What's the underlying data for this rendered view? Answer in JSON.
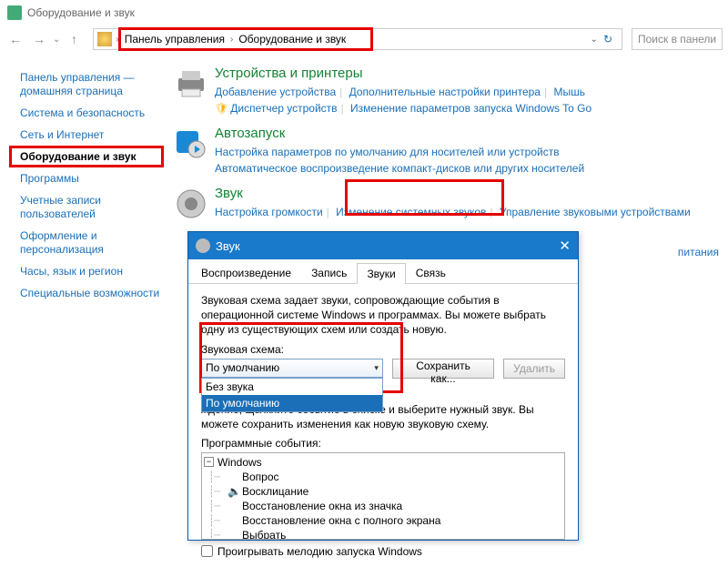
{
  "window_title": "Оборудование и звук",
  "nav": {
    "breadcrumb": [
      "Панель управления",
      "Оборудование и звук"
    ],
    "search_placeholder": "Поиск в панели"
  },
  "sidebar": {
    "items": [
      "Панель управления — домашняя страница",
      "Система и безопасность",
      "Сеть и Интернет",
      "Оборудование и звук",
      "Программы",
      "Учетные записи пользователей",
      "Оформление и персонализация",
      "Часы, язык и регион",
      "Специальные возможности"
    ],
    "selected_index": 3
  },
  "categories": [
    {
      "title": "Устройства и принтеры",
      "links": [
        "Добавление устройства",
        "Дополнительные настройки принтера",
        "Мышь"
      ],
      "shield_links": [
        "Диспетчер устройств",
        "Изменение параметров запуска Windows To Go"
      ]
    },
    {
      "title": "Автозапуск",
      "links": [
        "Настройка параметров по умолчанию для носителей или устройств",
        "Автоматическое воспроизведение компакт-дисков или других носителей"
      ]
    },
    {
      "title": "Звук",
      "links": [
        "Настройка громкости",
        "Изменение системных звуков",
        "Управление звуковыми устройствами"
      ]
    }
  ],
  "extra_visible_link": "питания",
  "dialog": {
    "title": "Звук",
    "tabs": [
      "Воспроизведение",
      "Запись",
      "Звуки",
      "Связь"
    ],
    "active_tab": 2,
    "desc": "Звуковая схема задает звуки, сопровождающие события в операционной системе Windows и программах. Вы можете выбрать одну из существующих схем или создать новую.",
    "scheme_label": "Звуковая схема:",
    "scheme_selected": "По умолчанию",
    "scheme_options": [
      "Без звука",
      "По умолчанию"
    ],
    "save_as": "Сохранить как...",
    "delete": "Удалить",
    "desc2_part": "ждение, щелкните событие в списке и выберите нужный звук. Вы можете сохранить изменения как новую звуковую схему.",
    "events_label": "Программные события:",
    "events_root": "Windows",
    "events": [
      "Вопрос",
      "Восклицание",
      "Восстановление окна из значка",
      "Восстановление окна с полного экрана",
      "Выбрать"
    ],
    "play_startup": "Проигрывать мелодию запуска Windows"
  }
}
